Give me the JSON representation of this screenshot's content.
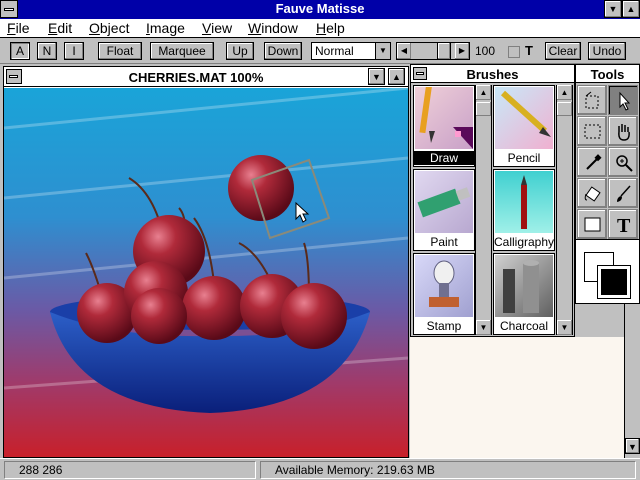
{
  "app": {
    "title": "Fauve Matisse"
  },
  "menu": [
    "File",
    "Edit",
    "Object",
    "Image",
    "View",
    "Window",
    "Help"
  ],
  "toolbar": {
    "mode_a": "A",
    "mode_n": "N",
    "mode_i": "I",
    "float": "Float",
    "marquee": "Marquee",
    "up": "Up",
    "down": "Down",
    "blend_mode": "Normal",
    "opacity": "100",
    "text_toggle": "T",
    "clear": "Clear",
    "undo": "Undo"
  },
  "document": {
    "title": "CHERRIES.MAT 100%"
  },
  "brushes": {
    "title": "Brushes",
    "items": [
      "Draw",
      "Pencil",
      "Paint",
      "Calligraphy",
      "Stamp",
      "Charcoal"
    ],
    "selected": "Draw"
  },
  "tools": {
    "title": "Tools",
    "selected": "arrow-icon"
  },
  "status": {
    "coords": "288 286",
    "memory": "Available Memory: 219.63 MB"
  },
  "colors": {
    "titlebar": "#0000a8",
    "face": "#c0c0c0",
    "foreground": "#000000",
    "background": "#ffffff"
  }
}
